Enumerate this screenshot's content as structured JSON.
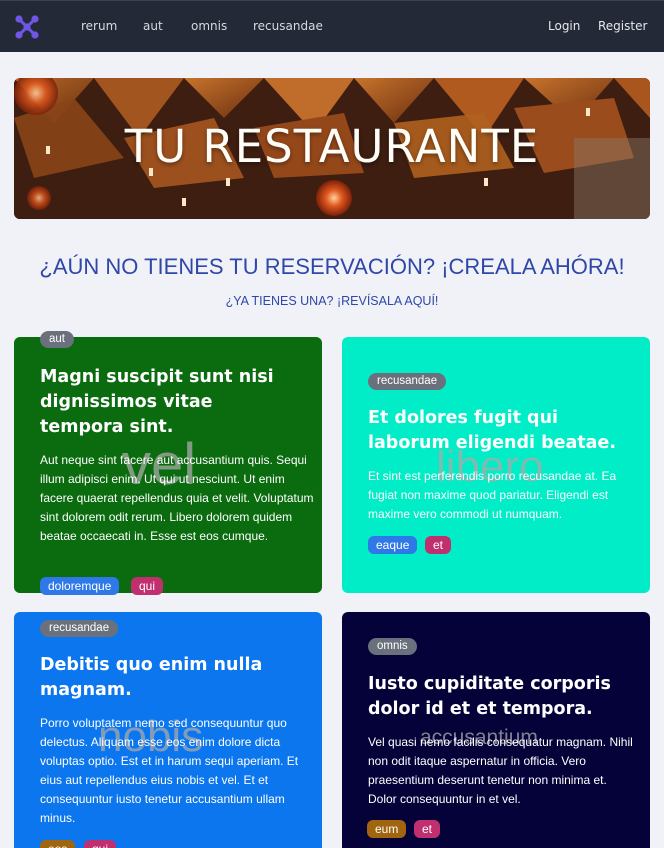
{
  "nav": {
    "links": [
      "rerum",
      "aut",
      "omnis",
      "recusandae"
    ],
    "login": "Login",
    "register": "Register"
  },
  "hero": {
    "title": "TU RESTAURANTE"
  },
  "headings": {
    "main": "¿AÚN NO TIENES TU RESERVACIÓN? ¡CREALA AHÓRA!",
    "sub": "¿YA TIENES UNA? ¡REVÍSALA AQUÍ!"
  },
  "cards": [
    {
      "tag": "aut",
      "title": "Magni suscipit sunt nisi dignissimos vitae tempora sint.",
      "body": "Aut neque sint facere aut accusantium quis. Sequi illum adipisci enim. Ut qui ut nesciunt. Ut enim facere quaerat repellendus quia et velit. Voluptatum sint dolorem odit rerum. Libero dolorem quidem beatae occaecati in. Esse est eos cumque.",
      "watermark": "vel",
      "pills": [
        "doloremque",
        "qui"
      ],
      "bg": "#0b6b0f"
    },
    {
      "tag": "recusandae",
      "title": "Et dolores fugit qui laborum eligendi beatae.",
      "body": "Et sint est perferendis porro recusandae at. Ea fugiat non maxime quod pariatur. Eligendi est maxime vero commodi ut numquam.",
      "watermark": "libero",
      "pills": [
        "eaque",
        "et"
      ],
      "bg": "#00edc8"
    },
    {
      "tag": "recusandae",
      "title": "Debitis quo enim nulla magnam.",
      "body": "Porro voluptatem nemo sed consequuntur quo delectus. Aliquam esse eos enim dolore dicta voluptas optio. Est et in harum sequi aperiam. Et eius aut repellendus eius nobis et vel. Et et consequuntur iusto tenetur accusantium ullam minus.",
      "watermark": "nobis",
      "pills": [
        "eos",
        "qui"
      ],
      "bg": "#0b76ee"
    },
    {
      "tag": "omnis",
      "title": "Iusto cupiditate corporis dolor id et et tempora.",
      "body": "Vel quasi nemo facilis consequatur magnam. Nihil non odit itaque aspernatur in officia. Vero praesentium deserunt tenetur non minima et. Dolor consequuntur in et vel.",
      "watermark": "accusantium",
      "pills": [
        "eum",
        "et"
      ],
      "bg": "#05023a"
    }
  ],
  "colors": {
    "navbar": "#232936",
    "heading": "#2f47a8",
    "logo": "#6f56e6",
    "pill_blue": "#2f78e8",
    "pill_pink": "#c0306e",
    "pill_brown": "#a0650e"
  }
}
